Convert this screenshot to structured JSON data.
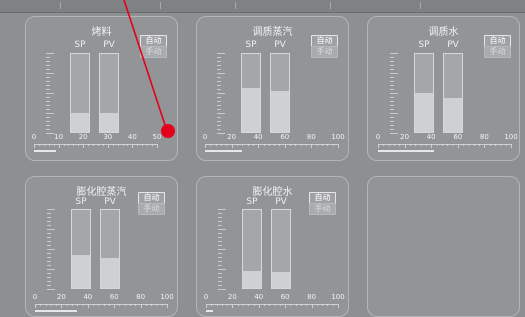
{
  "colors": {
    "background": "#8d8f92",
    "panel": "#929497",
    "fill": "#cfd0d2",
    "pointer": "#e3001b"
  },
  "panels": [
    {
      "title": "烤料",
      "sp_label": "SP",
      "pv_label": "PV",
      "auto_label": "自动",
      "manual_label": "手动",
      "sp_level": 0.24,
      "pv_level": 0.24,
      "ticks": [
        "0",
        "10",
        "20",
        "30",
        "40",
        "50"
      ],
      "track_fraction": 0.18
    },
    {
      "title": "调质蒸汽",
      "sp_label": "SP",
      "pv_label": "PV",
      "auto_label": "自动",
      "manual_label": "手动",
      "sp_level": 0.57,
      "pv_level": 0.52,
      "ticks": [
        "0",
        "20",
        "40",
        "60",
        "80",
        "100"
      ],
      "track_fraction": 0.28
    },
    {
      "title": "调质水",
      "sp_label": "SP",
      "pv_label": "PV",
      "auto_label": "自动",
      "manual_label": "手动",
      "sp_level": 0.5,
      "pv_level": 0.43,
      "ticks": [
        "0",
        "20",
        "40",
        "60",
        "80",
        "100"
      ],
      "track_fraction": 0.42
    },
    {
      "title": "膨化腔蒸汽",
      "sp_label": "SP",
      "pv_label": "PV",
      "auto_label": "自动",
      "manual_label": "手动",
      "sp_level": 0.42,
      "pv_level": 0.38,
      "ticks": [
        "0",
        "20",
        "40",
        "60",
        "80",
        "100"
      ],
      "track_fraction": 0.32
    },
    {
      "title": "膨化腔水",
      "sp_label": "SP",
      "pv_label": "PV",
      "auto_label": "自动",
      "manual_label": "手动",
      "sp_level": 0.22,
      "pv_level": 0.2,
      "ticks": [
        "0",
        "20",
        "40",
        "60",
        "80",
        "100"
      ],
      "track_fraction": 0.05
    }
  ]
}
